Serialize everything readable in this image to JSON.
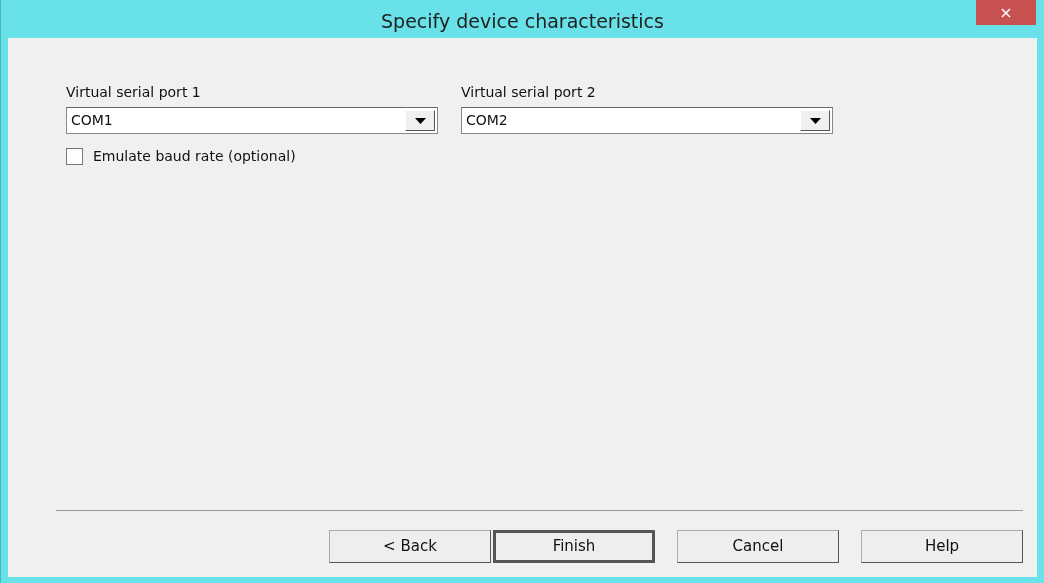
{
  "window": {
    "title": "Specify device characteristics",
    "close": "×"
  },
  "ports": [
    {
      "label": "Virtual serial port 1",
      "value": "COM1"
    },
    {
      "label": "Virtual serial port 2",
      "value": "COM2"
    }
  ],
  "options": [
    {
      "label": "Emulate baud rate (optional)",
      "checked": false
    }
  ],
  "buttons": [
    {
      "label": "< Back",
      "default": false
    },
    {
      "label": "Finish",
      "default": true
    },
    {
      "label": "Cancel",
      "default": false
    },
    {
      "label": "Help",
      "default": false
    }
  ]
}
